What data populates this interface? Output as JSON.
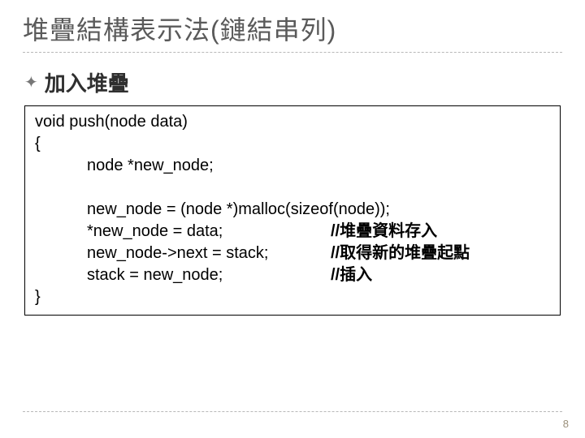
{
  "slide": {
    "title": "堆疊結構表示法(鏈結串列)",
    "bullet": "加入堆疊",
    "code": {
      "l1": "void push(node data)",
      "l2": "{",
      "l3": "node *new_node;",
      "l4": "new_node = (node *)malloc(sizeof(node));",
      "l5_code": "*new_node = data;",
      "l5_comment": "//堆疊資料存入",
      "l6_code": "new_node->next = stack;",
      "l6_comment": "//取得新的堆疊起點",
      "l7_code": "stack = new_node;",
      "l7_comment": "//插入",
      "l8": "}"
    },
    "page_number": "8"
  }
}
